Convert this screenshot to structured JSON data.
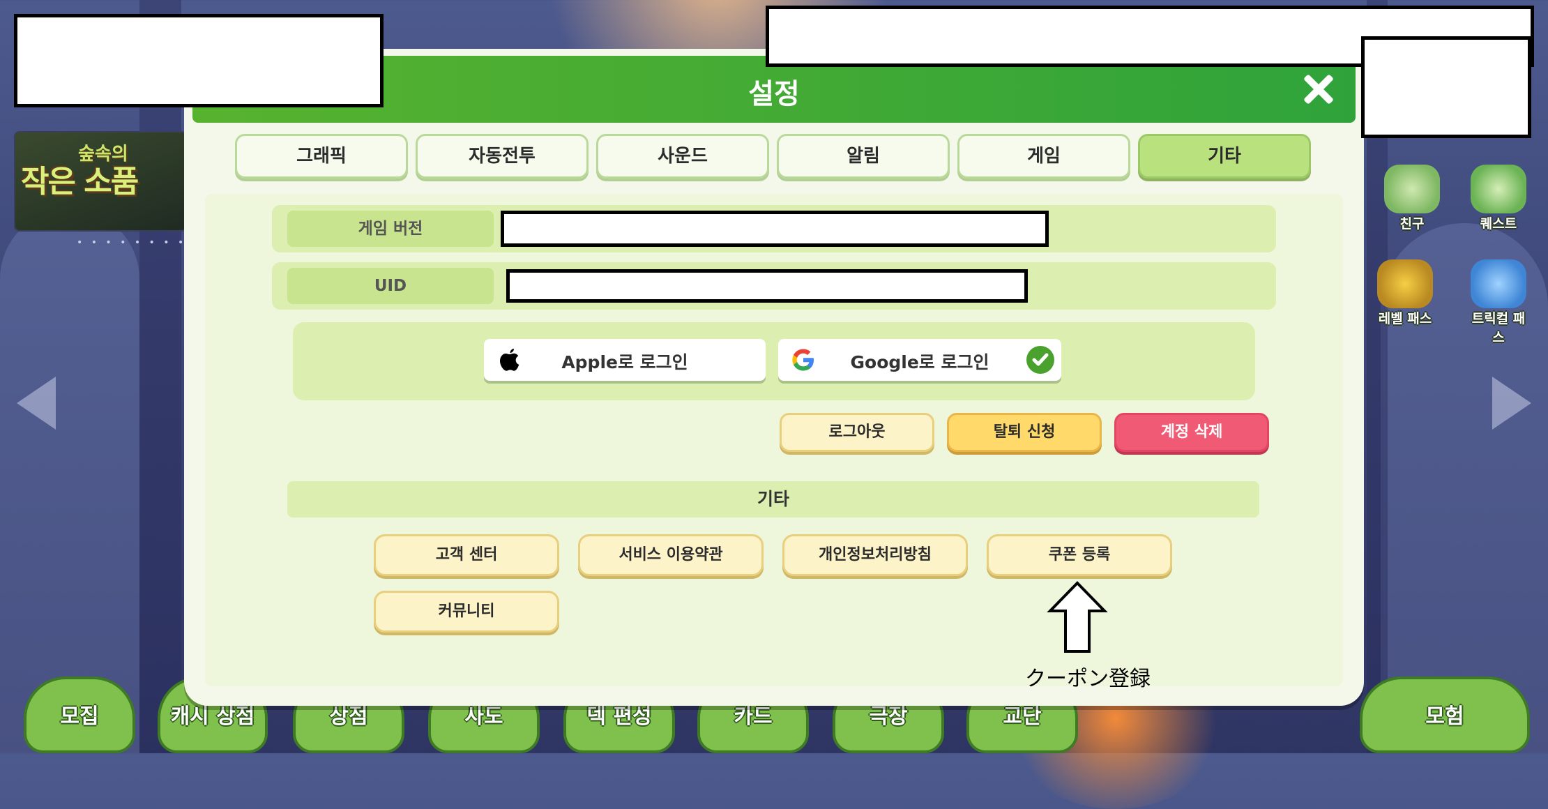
{
  "background": {
    "banner": {
      "title": "작은 소품",
      "subtitle": "숲속의"
    },
    "side_icons": [
      {
        "label": "친구",
        "icon": "friends-icon"
      },
      {
        "label": "퀘스트",
        "icon": "quest-icon"
      },
      {
        "label": "레벨 패스",
        "icon": "sunflower-icon"
      },
      {
        "label": "트릭컬 패스",
        "icon": "ticket-icon"
      }
    ],
    "bottom_tabs": [
      "모집",
      "캐시 상점",
      "상점",
      "사도",
      "덱 편성",
      "카드",
      "극장",
      "교단",
      "모험"
    ]
  },
  "dialog": {
    "title": "설정",
    "tabs": [
      {
        "label": "그래픽",
        "active": false
      },
      {
        "label": "자동전투",
        "active": false
      },
      {
        "label": "사운드",
        "active": false
      },
      {
        "label": "알림",
        "active": false
      },
      {
        "label": "게임",
        "active": false
      },
      {
        "label": "기타",
        "active": true
      }
    ],
    "info": {
      "version_label": "게임 버전",
      "uid_label": "UID"
    },
    "login": {
      "apple_label": "Apple로 로그인",
      "google_label": "Google로 로그인",
      "google_linked": true
    },
    "account_actions": {
      "logout": "로그아웃",
      "withdraw": "탈퇴 신청",
      "delete": "계정 삭제"
    },
    "misc": {
      "section_title": "기타",
      "buttons": [
        "고객 센터",
        "서비스 이용약관",
        "개인정보처리방침",
        "쿠폰 등록",
        "커뮤니티"
      ]
    }
  },
  "annotation": {
    "text": "クーポン登録"
  },
  "colors": {
    "header_green": "#57b22f",
    "active_tab": "#b9e27f",
    "delete_red": "#f05a74",
    "withdraw_yellow": "#ffd96a"
  }
}
